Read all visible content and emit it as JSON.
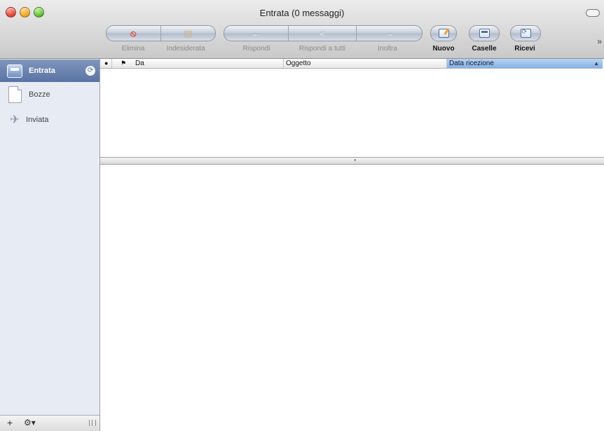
{
  "window": {
    "title": "Entrata (0 messaggi)"
  },
  "toolbar": {
    "delete_label": "Elimina",
    "junk_label": "Indesiderata",
    "reply_label": "Rispondi",
    "reply_all_label": "Rispondi a tutti",
    "forward_label": "Inoltra",
    "new_label": "Nuovo",
    "mailboxes_label": "Caselle",
    "get_mail_label": "Ricevi",
    "overflow_glyph": "»"
  },
  "sidebar": {
    "items": [
      {
        "label": "Entrata",
        "selected": true
      },
      {
        "label": "Bozze",
        "selected": false
      },
      {
        "label": "Inviata",
        "selected": false
      }
    ],
    "footer": {
      "add_glyph": "+",
      "action_glyph": "⚙▾"
    }
  },
  "message_list": {
    "columns": [
      {
        "label": "●",
        "kind": "read-status"
      },
      {
        "label": "⚑",
        "kind": "flag"
      },
      {
        "label": "Da",
        "kind": "from"
      },
      {
        "label": "Oggetto",
        "kind": "subject"
      },
      {
        "label": "Data ricezione",
        "kind": "date-received",
        "sorted": true
      }
    ],
    "sort_arrow": "▲",
    "rows": []
  },
  "icons": {
    "delete": "no-entry-icon",
    "junk": "junk-bin-icon",
    "reply": "arrow-left-icon",
    "reply_all": "double-arrow-left-icon",
    "forward": "arrow-right-icon",
    "new": "compose-icon",
    "mailboxes": "mailbox-icon",
    "get_mail": "get-mail-icon"
  },
  "colors": {
    "selection": "#5a73a3",
    "sidebar_bg": "#e6ebf4",
    "sorted_column": "#84b1e4"
  }
}
